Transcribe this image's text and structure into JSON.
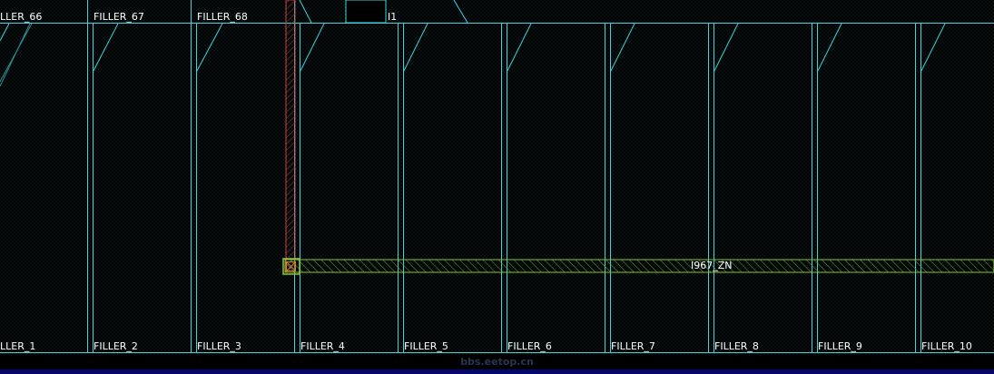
{
  "layout_view": {
    "top_row_labels": [
      "LLER_66",
      "FILLER_67",
      "FILLER_68",
      "I1"
    ],
    "bottom_row_labels": [
      "LLER_1",
      "FILLER_2",
      "FILLER_3",
      "FILLER_4",
      "FILLER_5",
      "FILLER_6",
      "FILLER_7",
      "FILLER_8",
      "FILLER_9",
      "FILLER_10"
    ],
    "net_label": "I967_ZN",
    "colors": {
      "background": "#000000",
      "cell_outline": "#3fd3dd",
      "route_metal": "#8ac83c",
      "via_metal": "#c04040",
      "label": "#ffffff"
    }
  },
  "watermark": "bbs.eetop.cn"
}
